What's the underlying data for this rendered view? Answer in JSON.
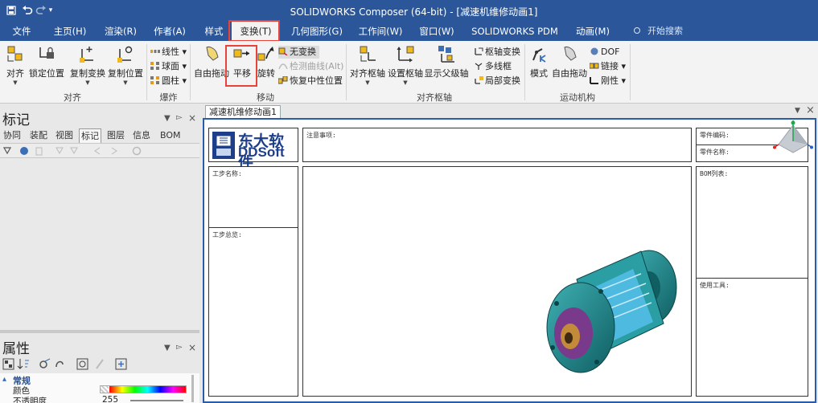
{
  "app": {
    "title": "SOLIDWORKS Composer (64-bit) - [减速机维修动画1]"
  },
  "quick_access": [
    "save-icon",
    "undo-icon",
    "redo-icon",
    "customize-dropdown-icon"
  ],
  "ribbon_tabs": [
    {
      "label": "文件"
    },
    {
      "label": "主页(H)"
    },
    {
      "label": "渲染(R)"
    },
    {
      "label": "作者(A)"
    },
    {
      "label": "样式"
    },
    {
      "label": "变换(T)",
      "active": true
    },
    {
      "label": "几何图形(G)"
    },
    {
      "label": "工作间(W)"
    },
    {
      "label": "窗口(W)"
    },
    {
      "label": "SOLIDWORKS PDM"
    },
    {
      "label": "动画(M)"
    }
  ],
  "search": {
    "placeholder": "开始搜索",
    "icon": "lightbulb-icon"
  },
  "ribbon": {
    "groups": {
      "align": {
        "label": "对齐",
        "buttons": [
          "对齐",
          "锁定位置",
          "复制变换",
          "复制位置"
        ]
      },
      "explode": {
        "label": "爆炸",
        "buttons": [
          "线性",
          "球面",
          "圆柱"
        ]
      },
      "move": {
        "label": "移动",
        "buttons": [
          "自由拖动",
          "平移",
          "旋转"
        ],
        "small": [
          "无变换",
          "检测曲线(Alt)",
          "恢复中性位置"
        ]
      },
      "pivot": {
        "label": "对齐枢轴",
        "buttons": [
          "对齐枢轴",
          "设置枢轴",
          "显示父级轴"
        ],
        "small": [
          "枢轴变换",
          "多线框",
          "局部变换"
        ]
      },
      "kinematics": {
        "label": "运动机构",
        "buttons": [
          "模式",
          "自由拖动"
        ],
        "small": [
          "DOF",
          "链接",
          "刚性"
        ]
      }
    }
  },
  "markers_pane": {
    "title": "标记",
    "tabs": [
      "协同",
      "装配",
      "视图",
      "标记",
      "图层",
      "信息",
      "BOM"
    ],
    "active_tab": "标记"
  },
  "properties_pane": {
    "title": "属性",
    "section": "常规",
    "rows": [
      {
        "label": "颜色",
        "value": ""
      },
      {
        "label": "不透明度",
        "value": "255"
      }
    ]
  },
  "viewport": {
    "doc_tab": "减速机维修动画1",
    "logo": {
      "cn": "东大软件",
      "en": "DDSoft"
    },
    "labels": {
      "notes": "注意事项:",
      "part_code": "零件编码:",
      "part_name": "零件名称:",
      "step_name": "工步名称:",
      "step_overview": "工步总览:",
      "bom_list": "BOM列表:",
      "tools_used": "使用工具:"
    }
  },
  "colors": {
    "title_bar": "#2b579a",
    "highlight": "#e8423b",
    "viewport_border": "#2a5caa",
    "model_teal": "#1f8a8c",
    "model_accent": "#7a3a8c",
    "model_blue": "#59c0f0"
  }
}
